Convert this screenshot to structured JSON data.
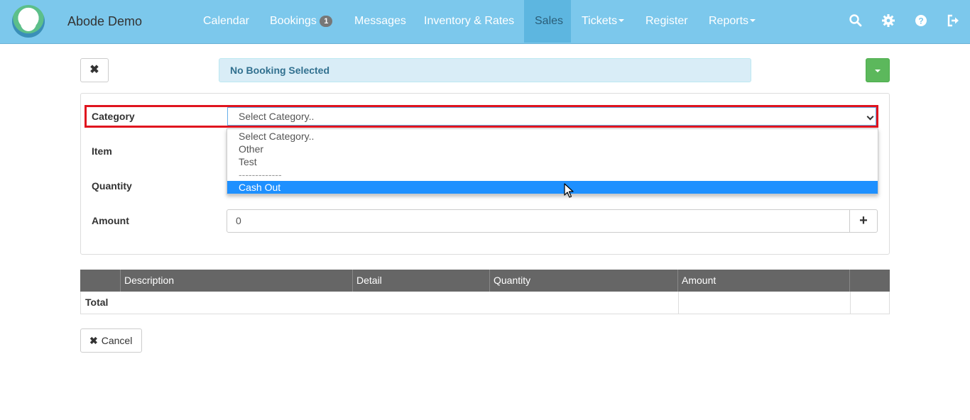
{
  "app": {
    "brand": "Abode Demo"
  },
  "nav": {
    "calendar": "Calendar",
    "bookings": "Bookings",
    "bookings_badge": "1",
    "messages": "Messages",
    "inventory": "Inventory & Rates",
    "sales": "Sales",
    "tickets": "Tickets",
    "register": "Register",
    "reports": "Reports"
  },
  "toolbar": {
    "close_label": "✖",
    "alert": "No Booking Selected"
  },
  "form": {
    "category_label": "Category",
    "item_label": "Item",
    "quantity_label": "Quantity",
    "amount_label": "Amount",
    "category_value": "Select Category..",
    "amount_value": "0",
    "add_label": "+"
  },
  "dropdown": {
    "options": [
      "Select Category..",
      "Other",
      "Test",
      "-------------",
      "Cash Out"
    ],
    "highlighted": "Cash Out"
  },
  "table": {
    "headers": [
      "",
      "Description",
      "Detail",
      "Quantity",
      "Amount",
      ""
    ],
    "total_label": "Total"
  },
  "footer": {
    "cancel_label": "Cancel",
    "cancel_icon": "✖"
  },
  "colors": {
    "navbar": "#7cc8ec",
    "highlight_border": "#e0141e",
    "selected_option": "#1e90ff",
    "green_button": "#5cb85c"
  }
}
